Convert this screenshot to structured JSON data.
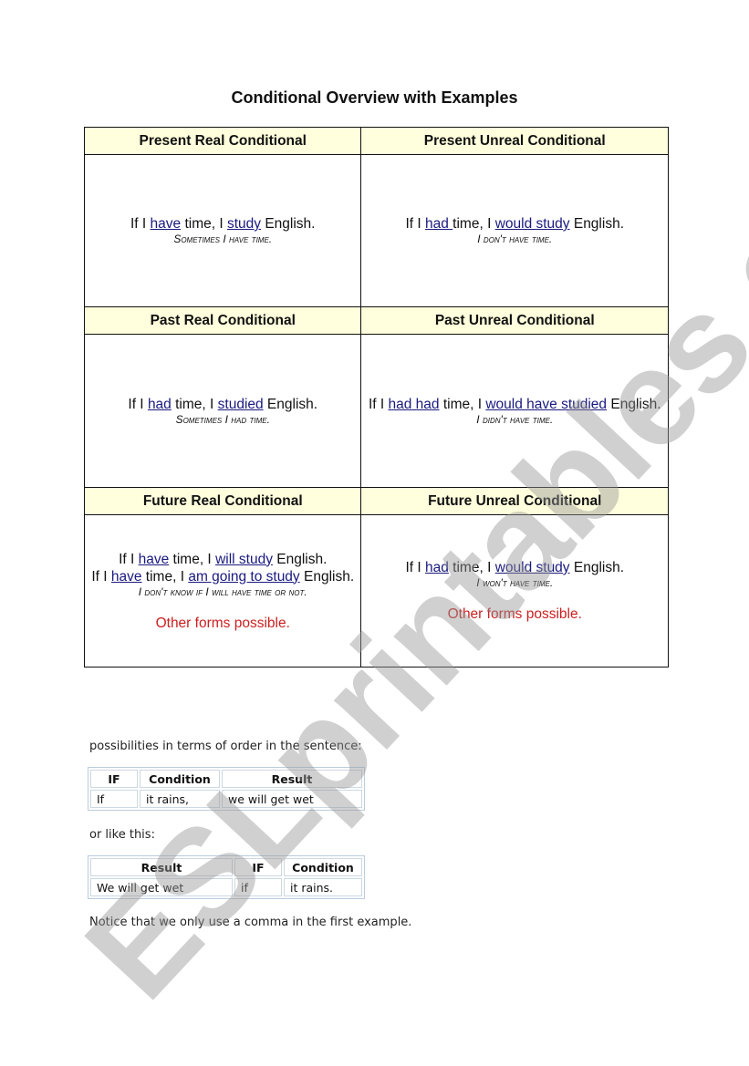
{
  "title": "Conditional Overview with Examples",
  "grid": [
    {
      "left": {
        "heading": "Present Real Conditional",
        "lines": [
          [
            {
              "t": "If I "
            },
            {
              "t": "have",
              "v": true
            },
            {
              "t": " time, I "
            },
            {
              "t": "study",
              "v": true
            },
            {
              "t": " English."
            }
          ]
        ],
        "note": "Sometimes I have time.",
        "other": ""
      },
      "right": {
        "heading": "Present Unreal Conditional",
        "lines": [
          [
            {
              "t": "If I "
            },
            {
              "t": "had ",
              "v": true
            },
            {
              "t": "time, I "
            },
            {
              "t": "would study",
              "v": true
            },
            {
              "t": " English."
            }
          ]
        ],
        "note": "I don't have time.",
        "other": ""
      }
    },
    {
      "left": {
        "heading": "Past Real Conditional",
        "lines": [
          [
            {
              "t": "If I "
            },
            {
              "t": "had",
              "v": true
            },
            {
              "t": " time, I "
            },
            {
              "t": "studied",
              "v": true
            },
            {
              "t": " English."
            }
          ]
        ],
        "note": "Sometimes I had time.",
        "other": ""
      },
      "right": {
        "heading": "Past Unreal Conditional",
        "lines": [
          [
            {
              "t": "If I "
            },
            {
              "t": "had had",
              "v": true
            },
            {
              "t": " time, I "
            },
            {
              "t": "would have studied",
              "v": true
            },
            {
              "t": " English."
            }
          ]
        ],
        "note": "I didn't have time.",
        "other": ""
      }
    },
    {
      "left": {
        "heading": "Future Real Conditional",
        "lines": [
          [
            {
              "t": "If I "
            },
            {
              "t": "have",
              "v": true
            },
            {
              "t": " time, I "
            },
            {
              "t": "will study",
              "v": true
            },
            {
              "t": " English."
            }
          ],
          [
            {
              "t": "If I "
            },
            {
              "t": "have",
              "v": true
            },
            {
              "t": " time, I "
            },
            {
              "t": "am going to study",
              "v": true
            },
            {
              "t": " English."
            }
          ]
        ],
        "note": "I don't know if I will have time or not.",
        "other": "Other forms possible."
      },
      "right": {
        "heading": "Future Unreal Conditional",
        "lines": [
          [
            {
              "t": "If I "
            },
            {
              "t": "had",
              "v": true
            },
            {
              "t": " time, I "
            },
            {
              "t": "would study",
              "v": true
            },
            {
              "t": " English."
            }
          ]
        ],
        "note": "I won't have time.",
        "other": "Other forms possible."
      }
    }
  ],
  "order_intro": "possibilities in terms of order in the sentence:",
  "table1": {
    "headers": [
      "IF",
      "Condition",
      "Result"
    ],
    "row": [
      "If",
      "it rains,",
      "we will get wet"
    ]
  },
  "or_like_this": "or like this:",
  "table2": {
    "headers": [
      "Result",
      "IF",
      "Condition"
    ],
    "row": [
      "We will get wet",
      "if",
      "it rains."
    ]
  },
  "notice": "Notice that we only use a comma in the first example.",
  "watermark": "ESLprintables.com",
  "colors": {
    "header_bg": "#ffffdd",
    "verb": "#1a1a80",
    "other_forms": "#cc2020"
  }
}
